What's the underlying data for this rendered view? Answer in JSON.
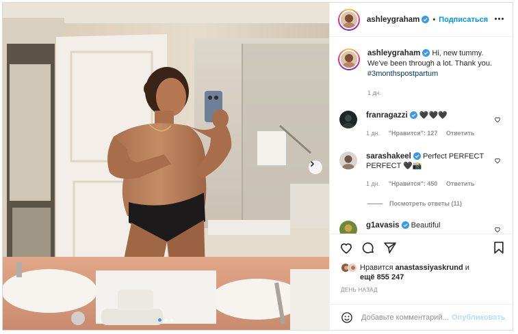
{
  "post": {
    "author": "ashleygraham",
    "follow_label": "Подписаться",
    "separator": "•",
    "caption_text": "Hi, new tummy. We've been through a lot. Thank you.",
    "caption_hashtag": "#3monthspostpartum",
    "caption_time": "1 дн."
  },
  "comments": [
    {
      "user": "franragazzi",
      "text": "🖤🖤🖤",
      "time": "1 дн.",
      "likes": "\"Нравится\": 127",
      "reply": "Ответить"
    },
    {
      "user": "sarashakeel",
      "text": "Perfect PERFECT PERFECT 🖤📸",
      "time": "1 дн.",
      "likes": "\"Нравится\": 450",
      "reply": "Ответить"
    },
    {
      "user": "g1avasis",
      "text": "Beautiful",
      "time": "",
      "likes": "",
      "reply": ""
    }
  ],
  "view_replies": "Посмотреть ответы (11)",
  "likes": {
    "prefix": "Нравится",
    "user": "anastassiyaskrund",
    "and": "и",
    "more": "ещё 855 247"
  },
  "date_label": "ДЕНЬ НАЗАД",
  "add_comment": {
    "placeholder": "Добавьте комментарий...",
    "publish_label": "Опубликовать"
  },
  "carousel": {
    "slides": 3,
    "active": 1
  },
  "icons": {
    "verified": "verified-badge-icon",
    "like": "heart-icon",
    "comment": "comment-icon",
    "share": "paper-plane-icon",
    "save": "bookmark-icon",
    "emoji": "smiley-icon",
    "more": "more-dots-icon",
    "next": "chevron-right-icon"
  },
  "colors": {
    "link": "#0095f6",
    "hashtag": "#00376b",
    "muted": "#8e8e8e",
    "verified": "#3897f0"
  }
}
